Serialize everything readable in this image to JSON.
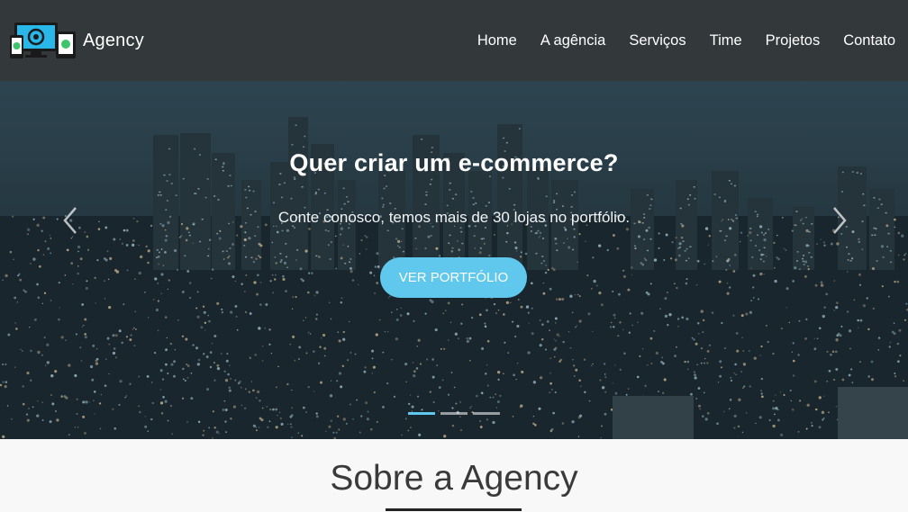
{
  "brand": {
    "name": "Agency",
    "logo": "devices-logo"
  },
  "nav": {
    "items": [
      "Home",
      "A agência",
      "Serviços",
      "Time",
      "Projetos",
      "Contato"
    ]
  },
  "hero": {
    "title": "Quer criar um e-commerce?",
    "subtitle": "Conte conosco, temos mais de 30 lojas no portfólio.",
    "cta_label": "VER PORTFÓLIO",
    "prev_icon": "chevron-left-icon",
    "next_icon": "chevron-right-icon",
    "slides_total": 3,
    "active_slide": 1
  },
  "about": {
    "title": "Sobre a Agency"
  },
  "colors": {
    "navbar": "#33383b",
    "accent": "#5fc8ec",
    "text_dark": "#3a3a3a"
  }
}
